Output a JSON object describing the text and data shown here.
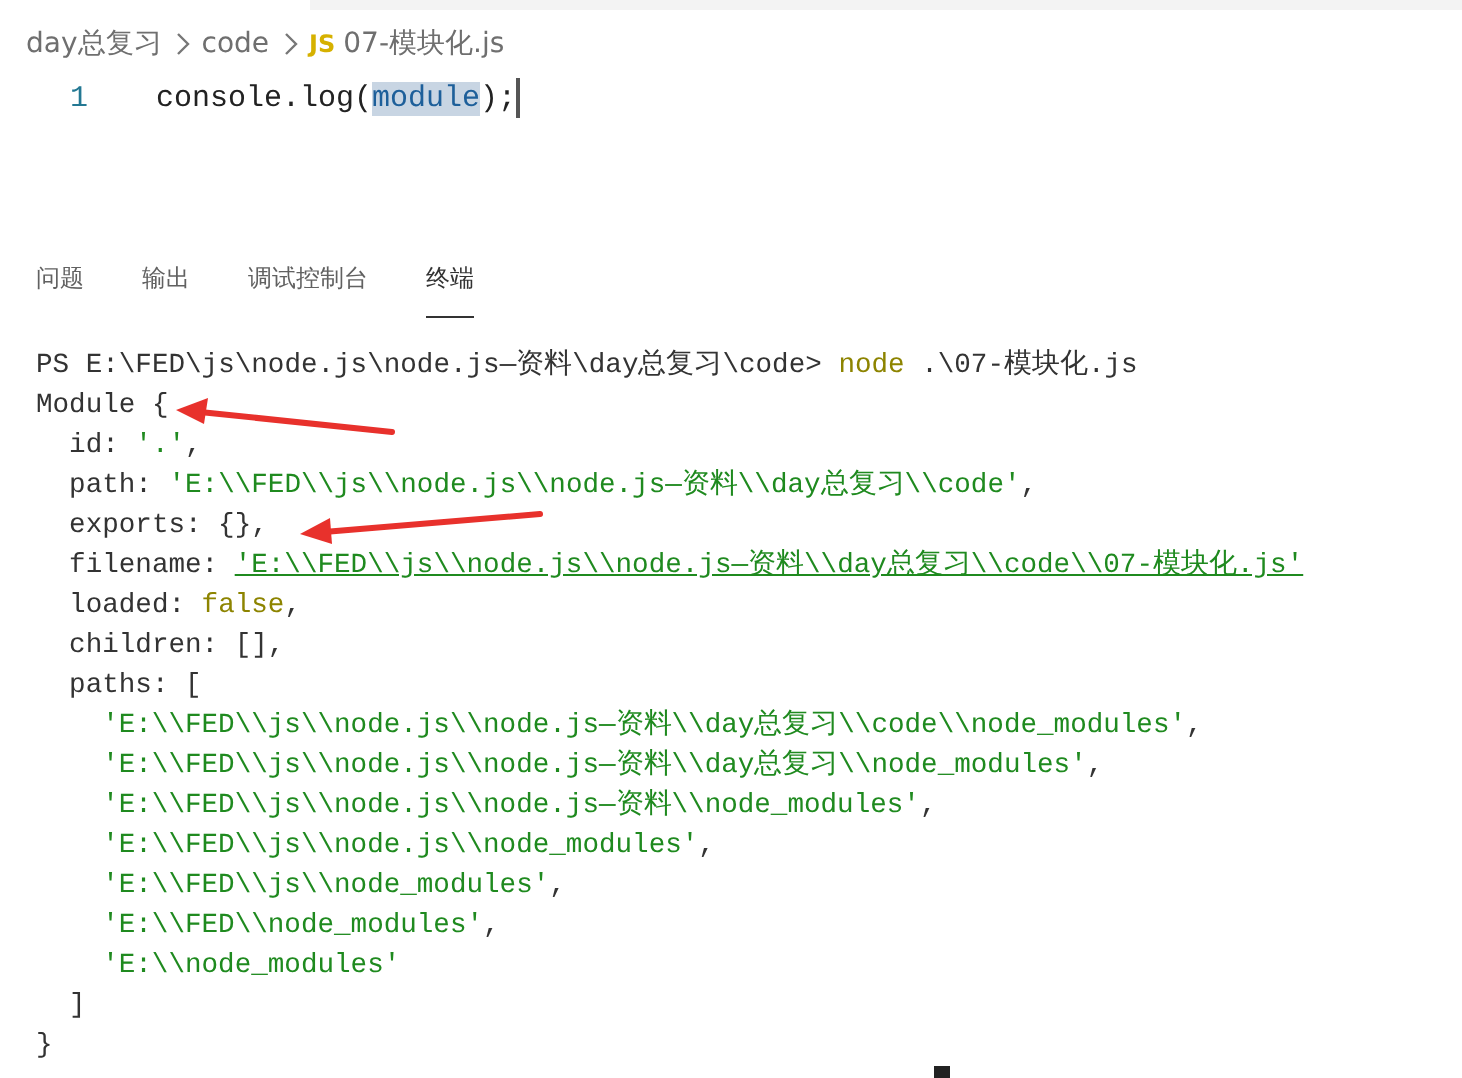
{
  "breadcrumb": {
    "items": [
      {
        "kind": "folder",
        "label": "day总复习"
      },
      {
        "kind": "folder",
        "label": "code"
      },
      {
        "kind": "file",
        "icon_label": "JS",
        "label": "07-模块化.js"
      }
    ]
  },
  "editor": {
    "lines": [
      {
        "number": "1",
        "segments": [
          {
            "kind": "plain",
            "text": "console.log("
          },
          {
            "kind": "highlight",
            "text": "module"
          },
          {
            "kind": "plain",
            "text": ");"
          }
        ]
      }
    ]
  },
  "panel_tabs": [
    {
      "label": "问题",
      "selected": false
    },
    {
      "label": "输出",
      "selected": false
    },
    {
      "label": "调试控制台",
      "selected": false
    },
    {
      "label": "终端",
      "selected": true
    }
  ],
  "terminal": {
    "lines": [
      {
        "segments": [
          {
            "kind": "plain",
            "text": "PS E:\\FED\\js\\node.js\\node.js—资料\\day总复习\\code> "
          },
          {
            "kind": "command",
            "text": "node"
          },
          {
            "kind": "plain",
            "text": " .\\07-模块化.js"
          }
        ]
      },
      {
        "segments": [
          {
            "kind": "plain",
            "text": "Module {"
          }
        ],
        "children": [
          {
            "segments": [
              {
                "kind": "plain",
                "text": "id: "
              },
              {
                "kind": "string",
                "text": "'.'"
              },
              {
                "kind": "plain",
                "text": ","
              }
            ]
          },
          {
            "segments": [
              {
                "kind": "plain",
                "text": "path: "
              },
              {
                "kind": "string",
                "text": "'E:\\\\FED\\\\js\\\\node.js\\\\node.js—资料\\\\day总复习\\\\code'"
              },
              {
                "kind": "plain",
                "text": ","
              }
            ]
          },
          {
            "segments": [
              {
                "kind": "plain",
                "text": "exports: {},"
              }
            ]
          },
          {
            "segments": [
              {
                "kind": "plain",
                "text": "filename: "
              },
              {
                "kind": "link",
                "text": "'E:\\\\FED\\\\js\\\\node.js\\\\node.js—资料\\\\day总复习\\\\code\\\\07-模块化.js'"
              }
            ]
          },
          {
            "segments": [
              {
                "kind": "plain",
                "text": "loaded: "
              },
              {
                "kind": "boolean",
                "text": "false"
              },
              {
                "kind": "plain",
                "text": ","
              }
            ]
          },
          {
            "segments": [
              {
                "kind": "plain",
                "text": "children: [],"
              }
            ]
          },
          {
            "segments": [
              {
                "kind": "plain",
                "text": "paths: ["
              }
            ],
            "children": [
              {
                "segments": [
                  {
                    "kind": "string",
                    "text": "'E:\\\\FED\\\\js\\\\node.js\\\\node.js—资料\\\\day总复习\\\\code\\\\node_modules'"
                  },
                  {
                    "kind": "plain",
                    "text": ","
                  }
                ]
              },
              {
                "segments": [
                  {
                    "kind": "string",
                    "text": "'E:\\\\FED\\\\js\\\\node.js\\\\node.js—资料\\\\day总复习\\\\node_modules'"
                  },
                  {
                    "kind": "plain",
                    "text": ","
                  }
                ]
              },
              {
                "segments": [
                  {
                    "kind": "string",
                    "text": "'E:\\\\FED\\\\js\\\\node.js\\\\node.js—资料\\\\node_modules'"
                  },
                  {
                    "kind": "plain",
                    "text": ","
                  }
                ]
              },
              {
                "segments": [
                  {
                    "kind": "string",
                    "text": "'E:\\\\FED\\\\js\\\\node.js\\\\node_modules'"
                  },
                  {
                    "kind": "plain",
                    "text": ","
                  }
                ]
              },
              {
                "segments": [
                  {
                    "kind": "string",
                    "text": "'E:\\\\FED\\\\js\\\\node_modules'"
                  },
                  {
                    "kind": "plain",
                    "text": ","
                  }
                ]
              },
              {
                "segments": [
                  {
                    "kind": "string",
                    "text": "'E:\\\\FED\\\\node_modules'"
                  },
                  {
                    "kind": "plain",
                    "text": ","
                  }
                ]
              },
              {
                "segments": [
                  {
                    "kind": "string",
                    "text": "'E:\\\\node_modules'"
                  }
                ]
              }
            ]
          },
          {
            "segments": [
              {
                "kind": "plain",
                "text": "]"
              }
            ]
          }
        ]
      },
      {
        "segments": [
          {
            "kind": "plain",
            "text": "}"
          }
        ]
      }
    ]
  }
}
